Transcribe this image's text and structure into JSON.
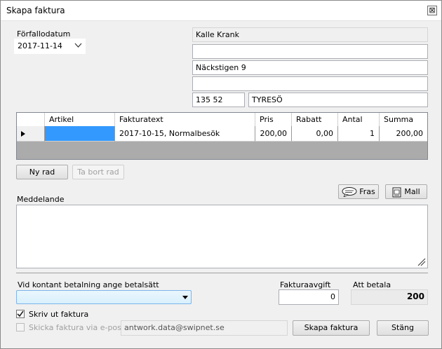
{
  "window": {
    "title": "Skapa faktura",
    "close_glyph": "⊠"
  },
  "due_date": {
    "label": "Förfallodatum",
    "value": "2017-11-14"
  },
  "address": {
    "name": "Kalle Krank",
    "line2": "",
    "street": "Näckstigen 9",
    "line4": "",
    "zip": "135 52",
    "city": "TYRESÖ"
  },
  "grid": {
    "headers": [
      "Artikel",
      "Fakturatext",
      "Pris",
      "Rabatt",
      "Antal",
      "Summa"
    ],
    "rows": [
      {
        "artikel": "",
        "fakturatext": "2017-10-15, Normalbesök",
        "pris": "200,00",
        "rabatt": "0,00",
        "antal": "1",
        "summa": "200,00"
      }
    ],
    "selected_color": "#3399ff"
  },
  "buttons": {
    "new_row": "Ny rad",
    "delete_row": "Ta bort rad",
    "phrase": "Fras",
    "template": "Mall",
    "create_invoice": "Skapa faktura",
    "close": "Stäng"
  },
  "message": {
    "label": "Meddelande",
    "value": ""
  },
  "payment": {
    "label": "Vid kontant betalning ange betalsätt",
    "value": ""
  },
  "invoice_fee": {
    "label": "Fakturaavgift",
    "value": "0"
  },
  "to_pay": {
    "label": "Att betala",
    "value": "200"
  },
  "print_invoice": {
    "label": "Skriv ut faktura",
    "checked": true
  },
  "email_invoice": {
    "label": "Skicka faktura via e-post",
    "checked": false,
    "email": "antwork.data@swipnet.se"
  }
}
